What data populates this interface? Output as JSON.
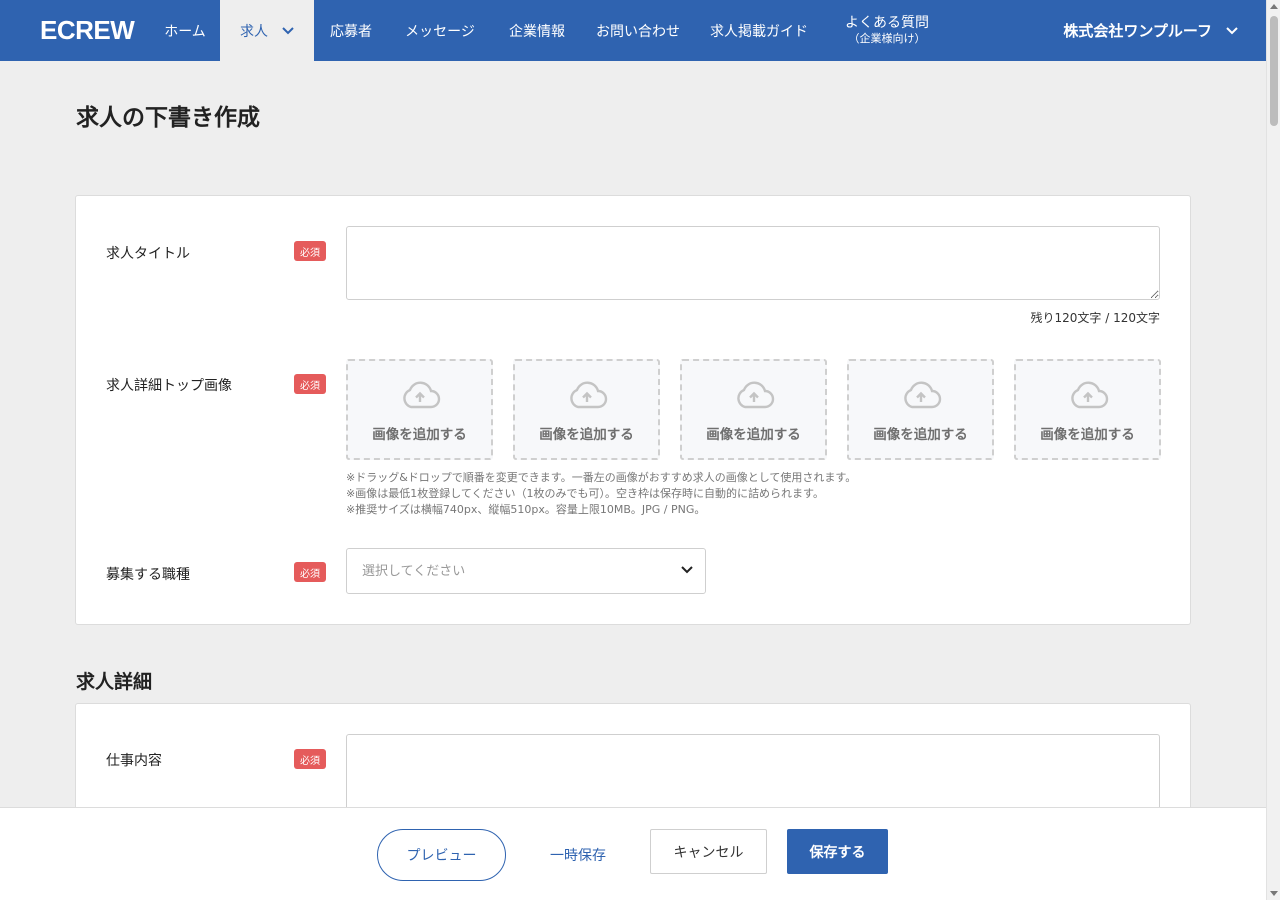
{
  "nav": {
    "logo": "ECREW",
    "items": [
      {
        "label": "ホーム"
      },
      {
        "label": "求人"
      },
      {
        "label": "応募者"
      },
      {
        "label": "メッセージ"
      },
      {
        "label": "企業情報"
      },
      {
        "label": "お問い合わせ"
      },
      {
        "label": "求人掲載ガイド"
      }
    ],
    "faq": {
      "line1": "よくある質問",
      "line2": "（企業様向け）"
    },
    "company": "株式会社ワンプルーフ",
    "colors": {
      "bar": "#2f63b0",
      "active_bg": "#eeeeee"
    }
  },
  "page": {
    "title": "求人の下書き作成"
  },
  "form": {
    "required_badge": "必須",
    "job_title": {
      "label": "求人タイトル",
      "value": "",
      "char_count": "残り120文字 / 120文字"
    },
    "top_images": {
      "label": "求人詳細トップ画像",
      "add_label": "画像を追加する",
      "slots": 5,
      "notes": [
        "※ドラッグ&ドロップで順番を変更できます。一番左の画像がおすすめ求人の画像として使用されます。",
        "※画像は最低1枚登録してください（1枚のみでも可）。空き枠は保存時に自動的に詰められます。",
        "※推奨サイズは横幅740px、縦幅510px。容量上限10MB。JPG / PNG。"
      ]
    },
    "occupation": {
      "label": "募集する職種",
      "placeholder": "選択してください"
    }
  },
  "details": {
    "title": "求人詳細",
    "job_description": {
      "label": "仕事内容",
      "value": ""
    }
  },
  "footer": {
    "preview": "プレビュー",
    "draft": "一時保存",
    "cancel": "キャンセル",
    "save": "保存する"
  },
  "colors": {
    "primary": "#2f63b0",
    "required": "#e55b5b",
    "background": "#eeeeee"
  }
}
